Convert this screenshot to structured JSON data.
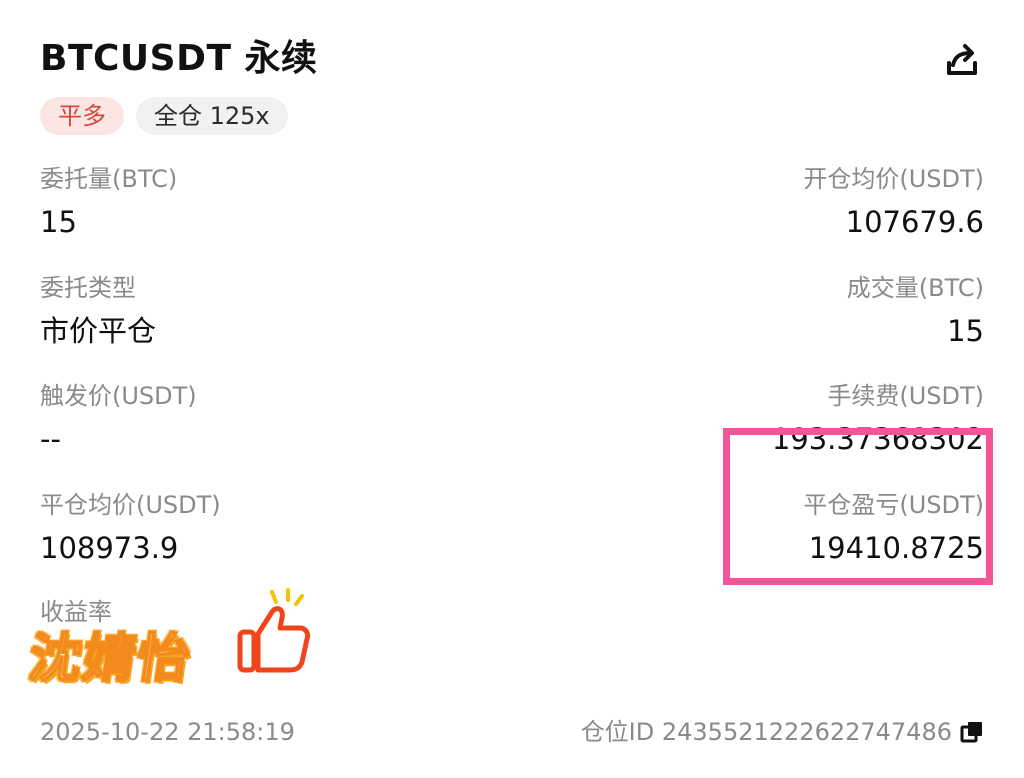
{
  "header": {
    "title": "BTCUSDT 永续",
    "share_icon": "share-icon"
  },
  "tags": {
    "side": "平多",
    "margin": "全仓 125x"
  },
  "fields": {
    "order_qty_label": "委托量(BTC)",
    "order_qty_value": "15",
    "open_avg_label": "开仓均价(USDT)",
    "open_avg_value": "107679.6",
    "order_type_label": "委托类型",
    "order_type_value": "市价平仓",
    "filled_qty_label": "成交量(BTC)",
    "filled_qty_value": "15",
    "trigger_price_label": "触发价(USDT)",
    "trigger_price_value": "--",
    "fee_label": "手续费(USDT)",
    "fee_value": "193.37368302",
    "close_avg_label": "平仓均价(USDT)",
    "close_avg_value": "108973.9",
    "close_pnl_label": "平仓盈亏(USDT)",
    "close_pnl_value": "19410.8725",
    "roi_label": "收益率"
  },
  "sticker": {
    "text": "沈婧怡",
    "icon": "thumbs-up-icon"
  },
  "footer": {
    "timestamp": "2025-10-22 21:58:19",
    "position_id": "仓位ID 2435521222622747486",
    "copy_icon": "copy-icon"
  },
  "colors": {
    "highlight": "#f2559a",
    "side_tag_bg": "#fbe6e4",
    "side_tag_text": "#d4463f",
    "sticker_orange": "#f28a1c"
  }
}
